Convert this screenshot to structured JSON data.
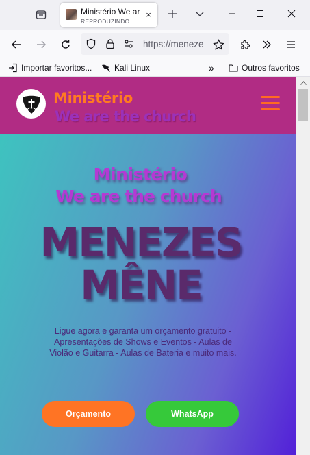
{
  "browser": {
    "tab": {
      "title": "Ministério We are the church",
      "subtitle": "REPRODUZINDO",
      "close_glyph": "×"
    },
    "url": "https://menezesmene.com.br",
    "bookmarks": [
      {
        "label": "Importar favoritos...",
        "icon": "import-icon"
      },
      {
        "label": "Kali Linux",
        "icon": "kali-dragon-icon"
      }
    ],
    "bookmarks_overflow": "»",
    "other_bookmarks": {
      "label": "Outros favoritos",
      "icon": "folder-icon"
    }
  },
  "site": {
    "header": {
      "brand_line1": "Ministério",
      "brand_line2": "We are the church"
    },
    "hero": {
      "line1": "Ministério",
      "line2": "We are the church",
      "title_line1": "MENEZES",
      "title_line2": "MÊNE",
      "description": "Ligue agora e garanta um orçamento gratuito - Apresentações de Shows e Eventos - Aulas de Violão e Guitarra - Aulas de Bateria e muito mais.",
      "buttons": {
        "quote": "Orçamento",
        "whatsapp": "WhatsApp"
      }
    }
  },
  "colors": {
    "header_bg": "#b12c84",
    "brand_orange": "#ff7a21",
    "brand_purple": "#9b31b9",
    "hero_gradient_start": "#3ec3bf",
    "hero_gradient_end": "#5220d8",
    "quote_button": "#ff7424",
    "whatsapp_button": "#36c93a"
  }
}
